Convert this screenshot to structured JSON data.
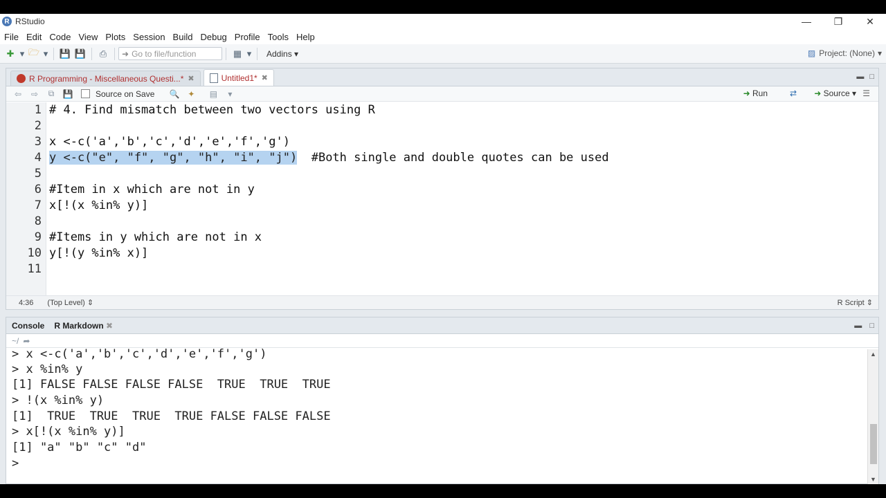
{
  "window": {
    "title": "RStudio",
    "logo_letter": "R"
  },
  "menu": [
    "File",
    "Edit",
    "Code",
    "View",
    "Plots",
    "Session",
    "Build",
    "Debug",
    "Profile",
    "Tools",
    "Help"
  ],
  "toolbar": {
    "goto_placeholder": "Go to file/function",
    "addins_label": "Addins",
    "project_label": "Project: (None)"
  },
  "source": {
    "tabs": [
      {
        "label": "R Programming - Miscellaneous Questi...*",
        "active": false
      },
      {
        "label": "Untitled1*",
        "active": true
      }
    ],
    "source_on_save_label": "Source on Save",
    "run_label": "Run",
    "source_label": "Source",
    "lines": [
      {
        "num": "1",
        "text": "# 4. Find mismatch between two vectors using R"
      },
      {
        "num": "2",
        "text": ""
      },
      {
        "num": "3",
        "text": "x <-c('a','b','c','d','e','f','g')"
      },
      {
        "num": "4",
        "text": "y <-c(\"e\", \"f\", \"g\", \"h\", \"i\", \"j\")",
        "comment": "#Both single and double quotes can be used"
      },
      {
        "num": "5",
        "text": ""
      },
      {
        "num": "6",
        "text": "#Item in x which are not in y"
      },
      {
        "num": "7",
        "text": "x[!(x %in% y)]"
      },
      {
        "num": "8",
        "text": ""
      },
      {
        "num": "9",
        "text": "#Items in y which are not in x"
      },
      {
        "num": "10",
        "text": "y[!(y %in% x)]"
      },
      {
        "num": "11",
        "text": ""
      }
    ],
    "status": {
      "position": "4:36",
      "scope": "(Top Level)",
      "file_type": "R Script"
    }
  },
  "console": {
    "tabs": [
      "Console",
      "R Markdown"
    ],
    "path": "~/",
    "lines": [
      "> x <-c('a','b','c','d','e','f','g')",
      "> x %in% y",
      "[1] FALSE FALSE FALSE FALSE  TRUE  TRUE  TRUE",
      "> !(x %in% y)",
      "[1]  TRUE  TRUE  TRUE  TRUE FALSE FALSE FALSE",
      "> x[!(x %in% y)]",
      "[1] \"a\" \"b\" \"c\" \"d\"",
      "> "
    ]
  }
}
